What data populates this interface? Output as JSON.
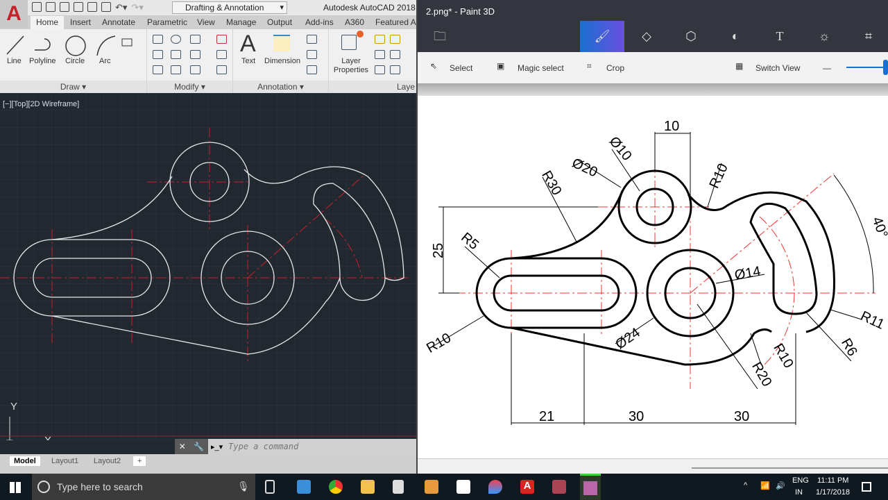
{
  "autocad": {
    "logo": "A",
    "workspace": "Drafting & Annotation",
    "title": "Autodesk AutoCAD 2018",
    "tabs": [
      "Home",
      "Insert",
      "Annotate",
      "Parametric",
      "View",
      "Manage",
      "Output",
      "Add-ins",
      "A360",
      "Featured Ap"
    ],
    "draw_tools": [
      "Line",
      "Polyline",
      "Circle",
      "Arc"
    ],
    "panels": [
      "Draw",
      "Modify",
      "Annotation",
      "Laye"
    ],
    "annotation_tools": [
      "Text",
      "Dimension"
    ],
    "layer_tool": "Layer Properties",
    "viewport_label": "[−][Top][2D Wireframe]",
    "ucs": {
      "x": "X",
      "y": "Y"
    },
    "command_placeholder": "Type a command",
    "layout_tabs": [
      "Model",
      "Layout1",
      "Layout2",
      "+"
    ]
  },
  "paint3d": {
    "title": "2.png* - Paint 3D",
    "tools": [
      "menu",
      "brushes",
      "2d-shapes",
      "3d-shapes",
      "stickers",
      "text",
      "effects",
      "canvas"
    ],
    "bar": {
      "select": "Select",
      "magic_select": "Magic select",
      "crop": "Crop",
      "switch_view": "Switch View",
      "zoom_out": "—"
    },
    "zoom_level": 0.95,
    "dimensions": {
      "d10top": "10",
      "dia10": "Ø10",
      "dia20": "Ø20",
      "r30": "R30",
      "r10a": "R10",
      "h25": "25",
      "r5": "R5",
      "a40": "40°",
      "dia14": "Ø14",
      "r10b": "R10",
      "dia24": "Ø24",
      "r11": "R11",
      "r6": "R6",
      "r10c": "R10",
      "r20": "R20",
      "w21": "21",
      "w30a": "30",
      "w30b": "30"
    }
  },
  "taskbar": {
    "search_placeholder": "Type here to search",
    "lang": "ENG",
    "region": "IN",
    "time": "11:11 PM",
    "date": "1/17/2018"
  }
}
